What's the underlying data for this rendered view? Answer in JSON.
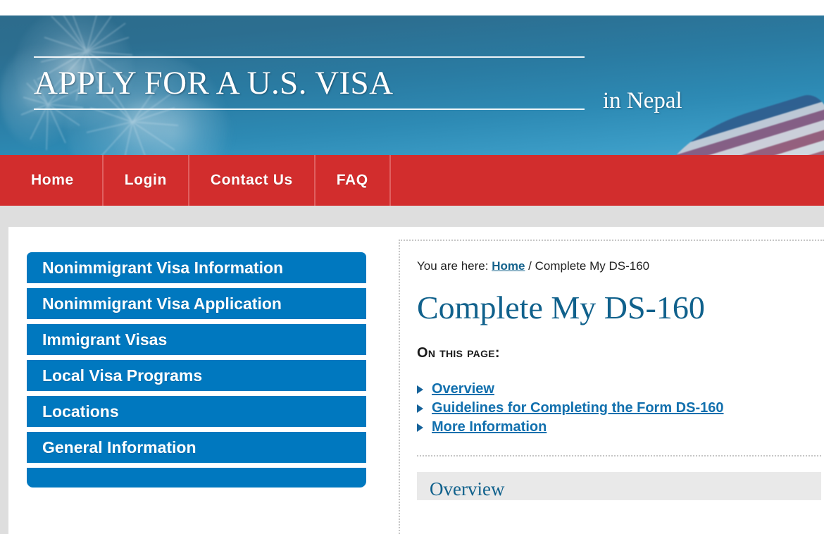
{
  "banner": {
    "title": "APPLY FOR A U.S. VISA",
    "subtitle": "in Nepal"
  },
  "nav": {
    "items": [
      {
        "label": "Home"
      },
      {
        "label": "Login"
      },
      {
        "label": "Contact Us"
      },
      {
        "label": "FAQ"
      }
    ]
  },
  "sidebar": {
    "items": [
      {
        "label": "Nonimmigrant Visa Information"
      },
      {
        "label": "Nonimmigrant Visa Application"
      },
      {
        "label": "Immigrant Visas"
      },
      {
        "label": "Local Visa Programs"
      },
      {
        "label": "Locations"
      },
      {
        "label": "General Information"
      },
      {
        "label": ""
      }
    ]
  },
  "main": {
    "breadcrumb": {
      "prefix": "You are here:",
      "home_label": "Home",
      "separator": "/",
      "current": "Complete My DS-160"
    },
    "page_title": "Complete My DS-160",
    "on_this_page_label": "On This Page:",
    "toc": [
      {
        "label": "Overview"
      },
      {
        "label": "Guidelines for Completing the Form DS-160"
      },
      {
        "label": "More Information"
      }
    ],
    "section_heading": "Overview"
  },
  "colors": {
    "nav_red": "#d22d2d",
    "sidebar_blue": "#0078bf",
    "heading_blue": "#10618c",
    "link_blue": "#1270ae",
    "page_gray": "#dedede"
  }
}
